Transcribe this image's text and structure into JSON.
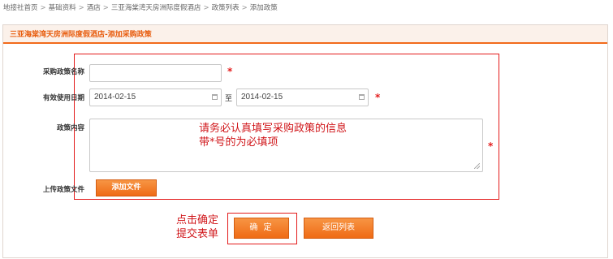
{
  "breadcrumb": {
    "items": [
      "地接社首页",
      "基础资料",
      "酒店",
      "三亚海棠湾天房洲际度假酒店",
      "政策列表",
      "添加政策"
    ],
    "separator": ">"
  },
  "panel": {
    "title": "三亚海棠湾天房洲际度假酒店-添加采购政策"
  },
  "form": {
    "policy_name": {
      "label": "采购政策名称",
      "value": "",
      "required_mark": "*"
    },
    "valid_dates": {
      "label": "有效使用日期",
      "start": "2014-02-15",
      "to_label": "至",
      "end": "2014-02-15",
      "required_mark": "*"
    },
    "content": {
      "label": "政策内容",
      "value": "",
      "required_mark": "*"
    },
    "upload": {
      "label": "上传政策文件",
      "button_label": "添加文件"
    }
  },
  "annotations": {
    "form_note_line1": "请务必认真填写采购政策的信息",
    "form_note_line2": "带*号的为必填项",
    "submit_note_line1": "点击确定",
    "submit_note_line2": "提交表单"
  },
  "actions": {
    "confirm_label": "确 定",
    "back_label": "返回列表"
  },
  "colors": {
    "accent": "#f26a1b",
    "annotation": "#e31b1b",
    "header_bg": "#fbf1ea"
  },
  "icons": {
    "date_picker": "calendar-icon",
    "textarea_grip": "resize-grip-icon"
  }
}
